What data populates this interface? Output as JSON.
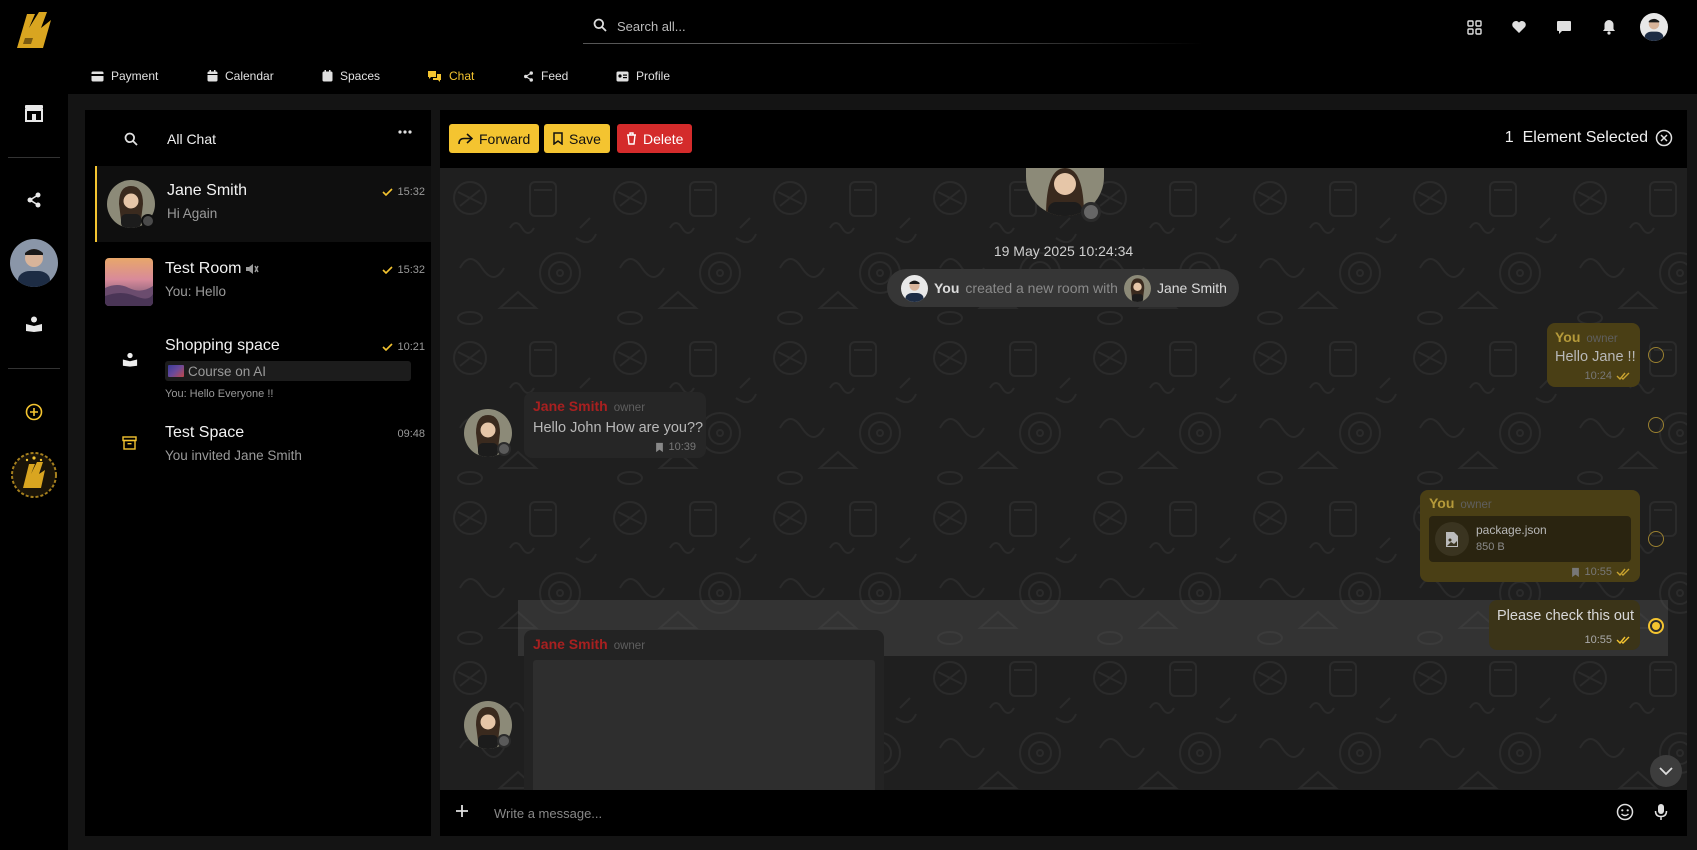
{
  "topbar": {
    "search_placeholder": "Search all...",
    "icons": [
      "apps-icon",
      "heart-icon",
      "chat-bubble-icon",
      "bell-icon"
    ]
  },
  "tabs": [
    {
      "label": "Payment",
      "icon": "credit-card-icon"
    },
    {
      "label": "Calendar",
      "icon": "calendar-icon"
    },
    {
      "label": "Spaces",
      "icon": "spaces-icon"
    },
    {
      "label": "Chat",
      "icon": "chat-icon",
      "active": true
    },
    {
      "label": "Feed",
      "icon": "share-icon"
    },
    {
      "label": "Profile",
      "icon": "id-card-icon"
    }
  ],
  "sidebar": {
    "icons": [
      "store-icon",
      "share-icon",
      "avatar",
      "book-reader-icon",
      "add-circle-icon",
      "badge-logo"
    ]
  },
  "conversation_list": {
    "title": "All Chat",
    "items": [
      {
        "name": "Jane Smith",
        "preview": "Hi Again",
        "time": "15:32",
        "read": true
      },
      {
        "name": "Test Room",
        "preview": "You: Hello",
        "time": "15:32",
        "read": true,
        "muted": true
      },
      {
        "name": "Shopping space",
        "tag": "Course on AI",
        "preview": "You: Hello Everyone !!",
        "time": "10:21",
        "read": true
      },
      {
        "name": "Test Space",
        "preview": "You invited Jane Smith",
        "time": "09:48"
      }
    ]
  },
  "chat": {
    "actions": {
      "forward": "Forward",
      "save": "Save",
      "delete": "Delete"
    },
    "selection_count": "1",
    "selection_label": "Element Selected",
    "date": "19 May 2025 10:24:34",
    "system_message": {
      "actor": "You",
      "text": "created a new room with",
      "target": "Jane Smith"
    },
    "messages": [
      {
        "sender": "You",
        "role": "owner",
        "text": "Hello Jane !!",
        "time": "10:24"
      },
      {
        "sender": "Jane Smith",
        "role": "owner",
        "text": "Hello John How are you??",
        "time": "10:39"
      },
      {
        "sender": "You",
        "role": "owner",
        "file_name": "package.json",
        "file_size": "850 B",
        "time": "10:55"
      },
      {
        "text": "Please check this out",
        "time": "10:55",
        "selected": true
      },
      {
        "sender": "Jane Smith",
        "role": "owner"
      }
    ],
    "compose_placeholder": "Write a message..."
  },
  "colors": {
    "accent": "#f4c430",
    "danger": "#d42b2b",
    "sender_red": "#a82020"
  }
}
